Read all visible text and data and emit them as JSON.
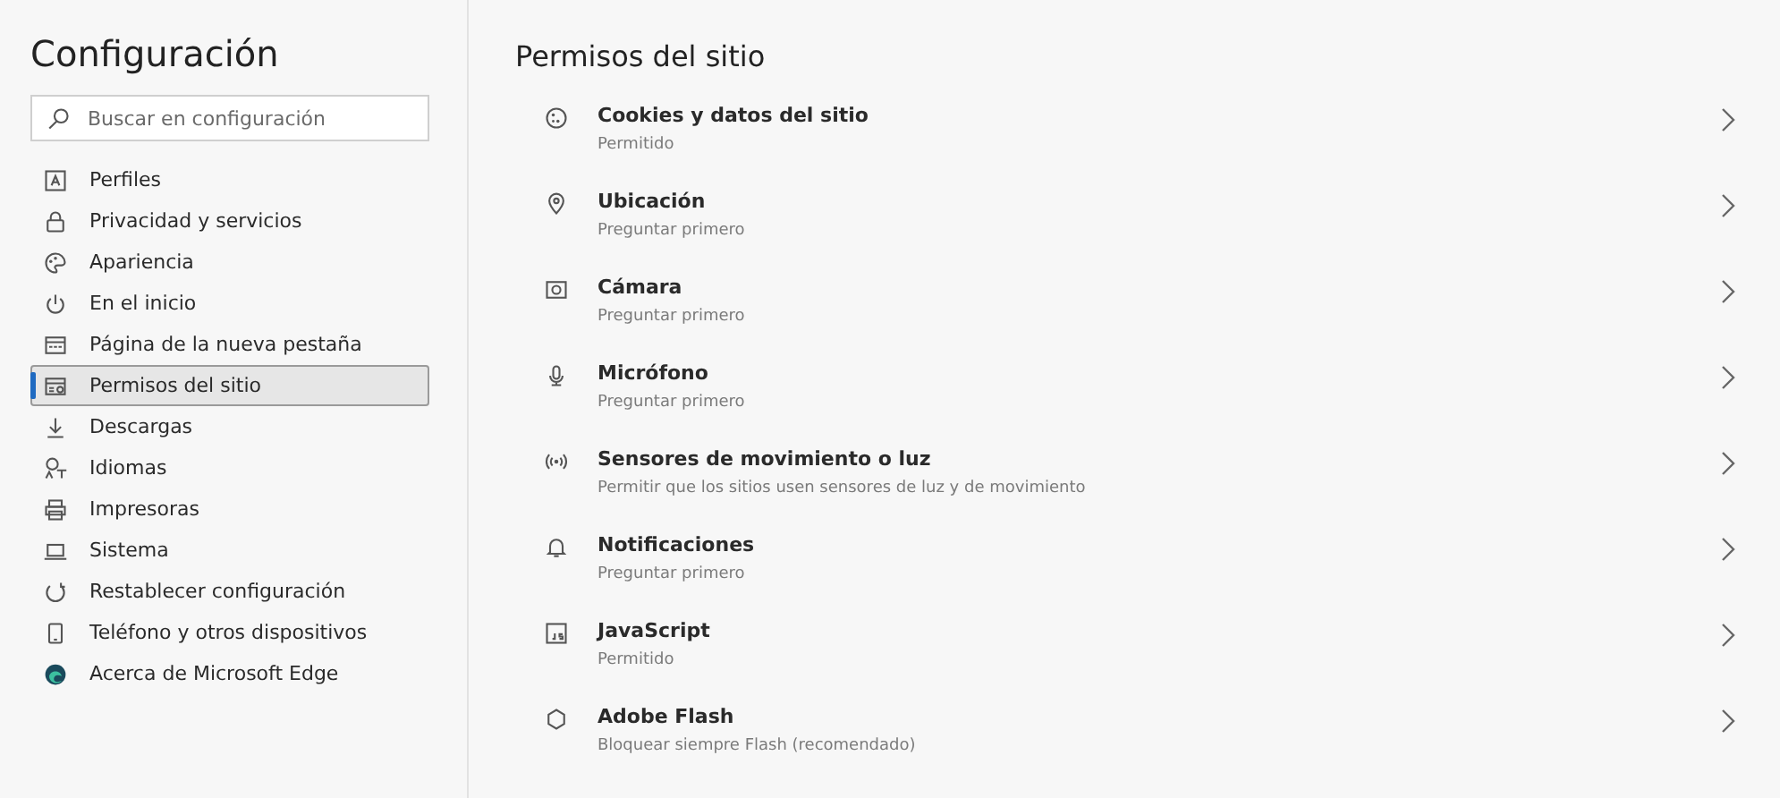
{
  "sidebar": {
    "title": "Configuración",
    "search": {
      "placeholder": "Buscar en configuración"
    },
    "items": [
      {
        "label": "Perfiles",
        "selected": false
      },
      {
        "label": "Privacidad y servicios",
        "selected": false
      },
      {
        "label": "Apariencia",
        "selected": false
      },
      {
        "label": "En el inicio",
        "selected": false
      },
      {
        "label": "Página de la nueva pestaña",
        "selected": false
      },
      {
        "label": "Permisos del sitio",
        "selected": true
      },
      {
        "label": "Descargas",
        "selected": false
      },
      {
        "label": "Idiomas",
        "selected": false
      },
      {
        "label": "Impresoras",
        "selected": false
      },
      {
        "label": "Sistema",
        "selected": false
      },
      {
        "label": "Restablecer configuración",
        "selected": false
      },
      {
        "label": "Teléfono y otros dispositivos",
        "selected": false
      },
      {
        "label": "Acerca de Microsoft Edge",
        "selected": false
      }
    ]
  },
  "main": {
    "title": "Permisos del sitio",
    "permissions": [
      {
        "name": "Cookies y datos del sitio",
        "status": "Permitido"
      },
      {
        "name": "Ubicación",
        "status": "Preguntar primero"
      },
      {
        "name": "Cámara",
        "status": "Preguntar primero"
      },
      {
        "name": "Micrófono",
        "status": "Preguntar primero"
      },
      {
        "name": "Sensores de movimiento o luz",
        "status": "Permitir que los sitios usen sensores de luz y de movimiento"
      },
      {
        "name": "Notificaciones",
        "status": "Preguntar primero"
      },
      {
        "name": "JavaScript",
        "status": "Permitido"
      },
      {
        "name": "Adobe Flash",
        "status": "Bloquear siempre Flash (recomendado)"
      }
    ]
  }
}
